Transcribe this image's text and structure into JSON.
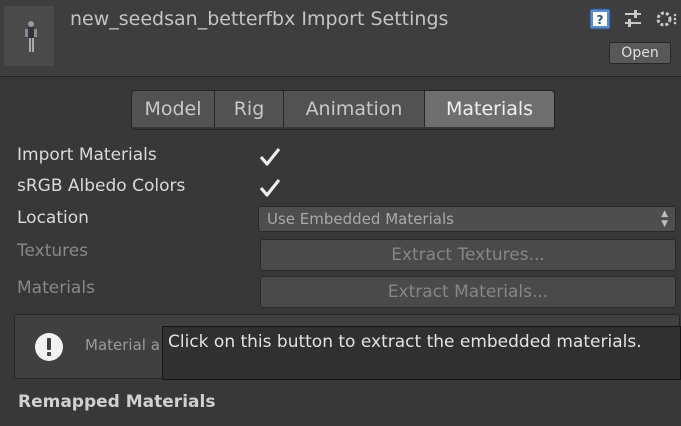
{
  "header": {
    "title": "new_seedsan_betterfbx Import Settings",
    "open_label": "Open",
    "icons": [
      "help-book-icon",
      "preset-sliders-icon",
      "gear-menu-icon"
    ]
  },
  "tabs": [
    {
      "label": "Model",
      "active": false
    },
    {
      "label": "Rig",
      "active": false
    },
    {
      "label": "Animation",
      "active": false
    },
    {
      "label": "Materials",
      "active": true
    }
  ],
  "settings": {
    "import_materials": {
      "label": "Import Materials",
      "checked": true
    },
    "srgb_albedo": {
      "label": "sRGB Albedo Colors",
      "checked": true
    },
    "location": {
      "label": "Location",
      "value": "Use Embedded Materials"
    },
    "textures": {
      "label": "Textures",
      "button": "Extract Textures..."
    },
    "materials": {
      "label": "Materials",
      "button": "Extract Materials..."
    }
  },
  "info": {
    "text": "Material a"
  },
  "tooltip": {
    "text": "Click on this button to extract the embedded materials."
  },
  "remapped": {
    "heading": "Remapped Materials"
  },
  "colors": {
    "background": "#383838",
    "header": "#3e3e3e",
    "active_tab": "#6e6e6e",
    "help_icon": "#5b8ccd"
  }
}
